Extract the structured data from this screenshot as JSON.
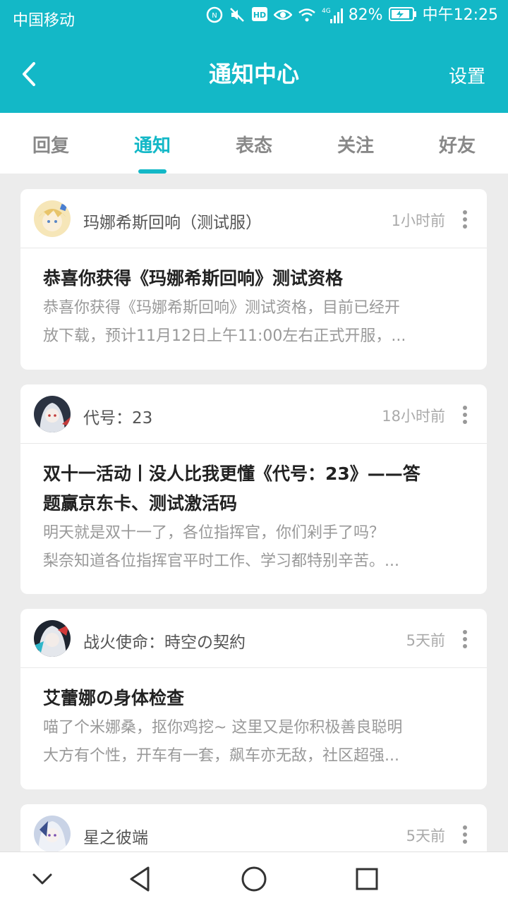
{
  "status_bar": {
    "carrier": "中国移动",
    "battery": "82%",
    "time": "中午12:25",
    "hd_label": "HD",
    "network_label": "4G"
  },
  "header": {
    "title": "通知中心",
    "settings": "设置"
  },
  "tabs": [
    "回复",
    "通知",
    "表态",
    "关注",
    "好友"
  ],
  "active_tab": "通知",
  "notifications": [
    {
      "game": "玛娜希斯回响（测试服）",
      "time": "1小时前",
      "title": "恭喜你获得《玛娜希斯回响》测试资格",
      "summary_line1": "恭喜你获得《玛娜希斯回响》测试资格，目前已经开",
      "summary_line2": "放下载，预计11月12日上午11:00左右正式开服，..."
    },
    {
      "game": "代号：23",
      "time": "18小时前",
      "title_line1": "双十一活动丨没人比我更懂《代号：23》——答",
      "title_line2": "题赢京东卡、测试激活码",
      "summary_line1": "明天就是双十一了，各位指挥官，你们剁手了吗？",
      "summary_line2": "梨奈知道各位指挥官平时工作、学习都特别辛苦。..."
    },
    {
      "game": "战火使命：時空の契約",
      "time": "5天前",
      "title": "艾蕾娜の身体检查",
      "summary_line1": "喵了个米娜桑，抠你鸡挖~ 这里又是你积极善良聪明",
      "summary_line2": "大方有个性，开车有一套，飙车亦无敌，社区超强..."
    },
    {
      "game": "星之彼端",
      "time": "5天前"
    }
  ],
  "colors": {
    "accent": "#13b8c7",
    "background": "#ececec"
  }
}
